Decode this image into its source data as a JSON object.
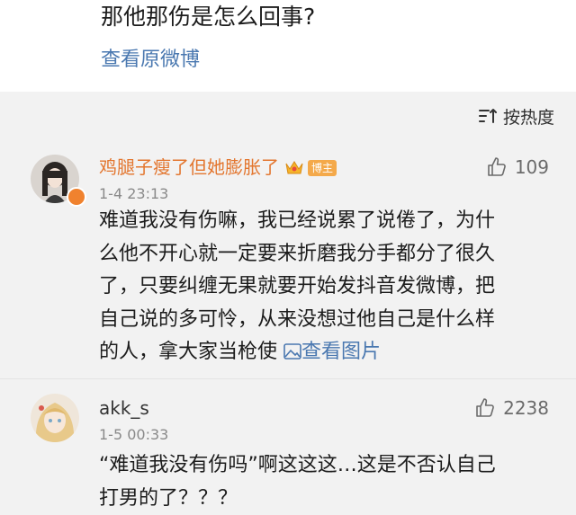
{
  "post": {
    "text": "那他那伤是怎么回事?",
    "view_original": "查看原微博"
  },
  "sort": {
    "label": "按热度"
  },
  "comments": [
    {
      "username": "鸡腿子瘦了但她膨胀了",
      "badge": "博主",
      "time": "1-4 23:13",
      "likes": "109",
      "lines": [
        "难道我没有伤嘛，我已经说累了说倦了，为什",
        "么他不开心就一定要来折磨我分手都分了很久",
        "了，只要纠缠无果就要开始发抖音发微博，把",
        "自己说的多可怜，从来没想过他自己是什么样",
        "的人，拿大家当枪使"
      ],
      "view_image": "查看图片"
    },
    {
      "username": "akk_s",
      "time": "1-5 00:33",
      "likes": "2238",
      "lines": [
        "“难道我没有伤吗”啊这这这…这是不否认自己",
        "打男的了？？？"
      ]
    }
  ],
  "colors": {
    "link": "#4a78b0",
    "vip_name": "#e3762f",
    "badge": "#f4a94a",
    "background": "#f2f2f2"
  }
}
